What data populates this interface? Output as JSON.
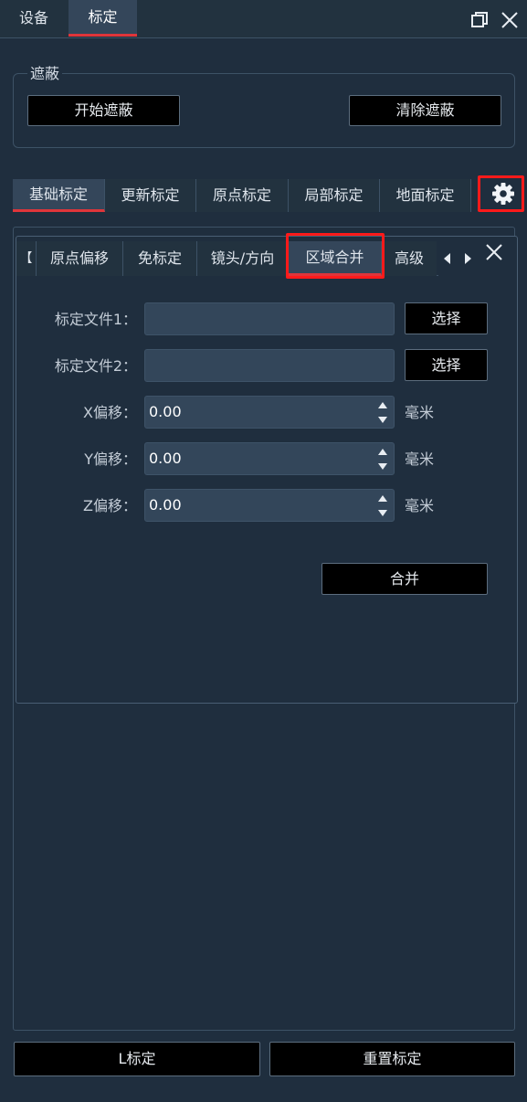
{
  "top_tabs": [
    "设备",
    "标定"
  ],
  "mask": {
    "title": "遮蔽",
    "start_label": "开始遮蔽",
    "clear_label": "清除遮蔽"
  },
  "calib_tabs": [
    "基础标定",
    "更新标定",
    "原点标定",
    "局部标定",
    "地面标定"
  ],
  "panel": {
    "tabs": [
      "原点偏移",
      "免标定",
      "镜头/方向",
      "区域合并",
      "高级"
    ],
    "partial_tab_glyph": "【",
    "file1_label": "标定文件1：",
    "file2_label": "标定文件2：",
    "file1_value": "",
    "file2_value": "",
    "select_label": "选择",
    "x_label": "X偏移：",
    "y_label": "Y偏移：",
    "z_label": "Z偏移：",
    "x_value": "0.00",
    "y_value": "0.00",
    "z_value": "0.00",
    "unit": "毫米",
    "merge_label": "合并"
  },
  "bottom": {
    "l_calib_label": "L标定",
    "reset_label": "重置标定"
  },
  "colors": {
    "background": "#1f2e3e",
    "active_tab": "#34465a",
    "accent_red": "#e0353a",
    "highlight_box": "#ff1a1a",
    "button_bg": "#000000",
    "field_bg": "#33465a"
  },
  "icons": [
    "restore-window-icon",
    "close-icon",
    "gear-icon",
    "panel-close-icon",
    "arrow-left-icon",
    "arrow-right-icon",
    "spin-up-icon",
    "spin-down-icon"
  ]
}
